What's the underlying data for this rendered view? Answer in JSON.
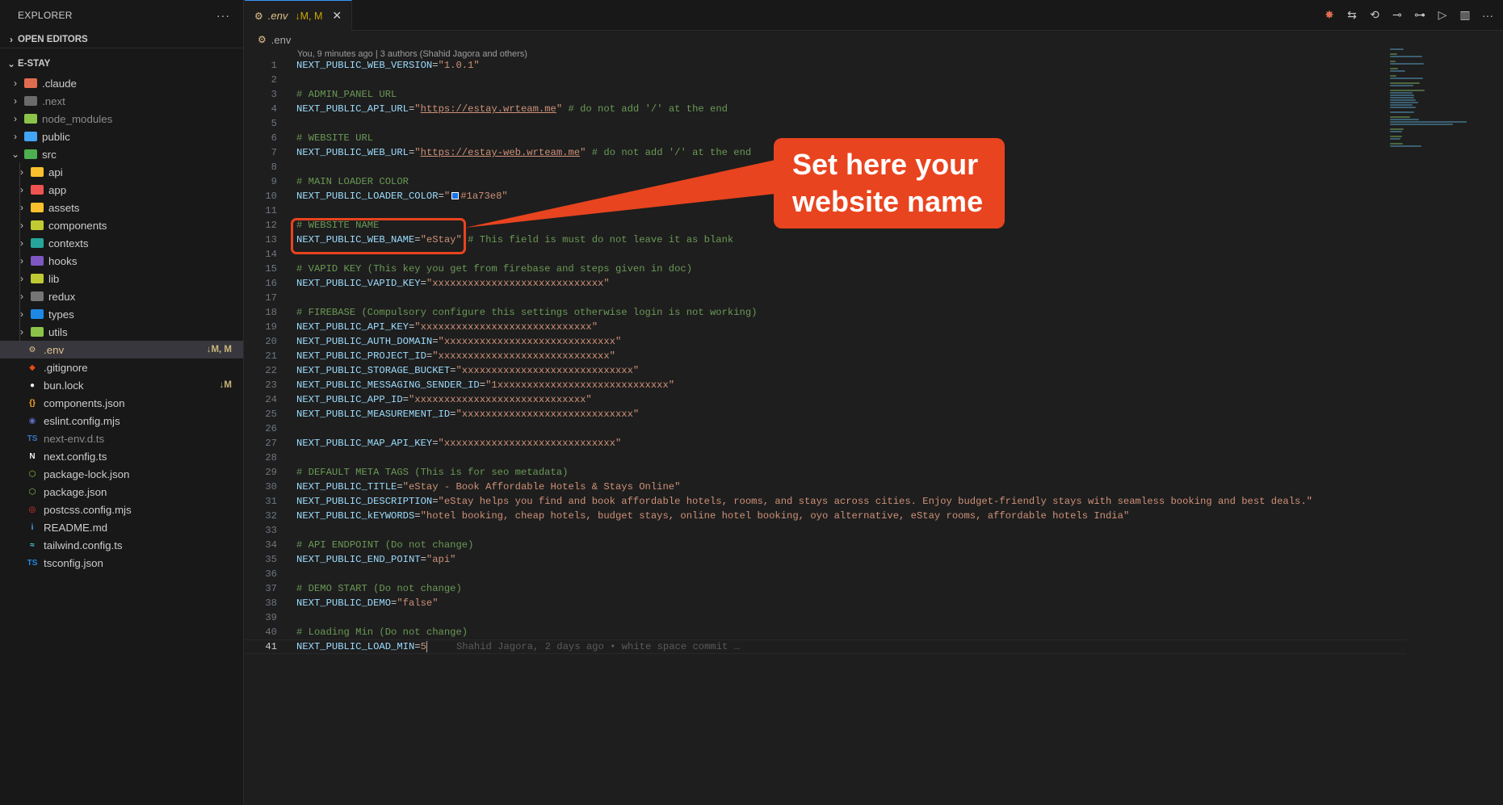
{
  "explorer": {
    "title": "EXPLORER",
    "more": "···",
    "open_editors": "OPEN EDITORS",
    "project": "E-STAY",
    "items": [
      {
        "label": ".claude",
        "type": "folder",
        "color": "#e06c4f",
        "dim": false,
        "badge": ""
      },
      {
        "label": ".next",
        "type": "folder",
        "color": "#6b6b6b",
        "dim": true,
        "badge": ""
      },
      {
        "label": "node_modules",
        "type": "folder",
        "color": "#8bc34a",
        "dim": true,
        "badge": ""
      },
      {
        "label": "public",
        "type": "folder",
        "color": "#42a5f5",
        "dim": false,
        "badge": ""
      },
      {
        "label": "src",
        "type": "folder-open",
        "color": "#4caf50",
        "dim": false,
        "badge": ""
      }
    ],
    "src_children": [
      {
        "label": "api",
        "color": "#fbc02d"
      },
      {
        "label": "app",
        "color": "#ef5350"
      },
      {
        "label": "assets",
        "color": "#fbc02d"
      },
      {
        "label": "components",
        "color": "#c0ca33"
      },
      {
        "label": "contexts",
        "color": "#26a69a"
      },
      {
        "label": "hooks",
        "color": "#7e57c2"
      },
      {
        "label": "lib",
        "color": "#c0ca33"
      },
      {
        "label": "redux",
        "color": "#757575"
      },
      {
        "label": "types",
        "color": "#1e88e5"
      },
      {
        "label": "utils",
        "color": "#8bc34a"
      }
    ],
    "files": [
      {
        "label": ".env",
        "icon": "⚙",
        "color": "#e2c08d",
        "badge": "↓M, M",
        "selected": true,
        "dim": false
      },
      {
        "label": ".gitignore",
        "icon": "◆",
        "color": "#e64a19",
        "badge": "",
        "selected": false,
        "dim": false
      },
      {
        "label": "bun.lock",
        "icon": "●",
        "color": "#f5f5f5",
        "badge": "↓M",
        "selected": false,
        "dim": false
      },
      {
        "label": "components.json",
        "icon": "{}",
        "color": "#f9a825",
        "badge": "",
        "selected": false,
        "dim": false
      },
      {
        "label": "eslint.config.mjs",
        "icon": "◉",
        "color": "#5c6bc0",
        "badge": "",
        "selected": false,
        "dim": false
      },
      {
        "label": "next-env.d.ts",
        "icon": "TS",
        "color": "#3178c6",
        "badge": "",
        "selected": false,
        "dim": true
      },
      {
        "label": "next.config.ts",
        "icon": "N",
        "color": "#eeeeee",
        "badge": "",
        "selected": false,
        "dim": false
      },
      {
        "label": "package-lock.json",
        "icon": "⬡",
        "color": "#8bc34a",
        "badge": "",
        "selected": false,
        "dim": false
      },
      {
        "label": "package.json",
        "icon": "⬡",
        "color": "#8bc34a",
        "badge": "",
        "selected": false,
        "dim": false
      },
      {
        "label": "postcss.config.mjs",
        "icon": "◎",
        "color": "#e53935",
        "badge": "",
        "selected": false,
        "dim": false
      },
      {
        "label": "README.md",
        "icon": "i",
        "color": "#42a5f5",
        "badge": "",
        "selected": false,
        "dim": false
      },
      {
        "label": "tailwind.config.ts",
        "icon": "≈",
        "color": "#4dd0e1",
        "badge": "",
        "selected": false,
        "dim": false
      },
      {
        "label": "tsconfig.json",
        "icon": "TS",
        "color": "#1e88e5",
        "badge": "",
        "selected": false,
        "dim": false
      }
    ]
  },
  "tab": {
    "icon": "⚙",
    "label": ".env",
    "badge": "↓M, M",
    "close": "✕"
  },
  "tab_actions": [
    "✸",
    "⇆",
    "⟲",
    "⊸",
    "⊶",
    "▷",
    "▥",
    "···"
  ],
  "breadcrumb": {
    "icon": "⚙",
    "label": ".env"
  },
  "blame_header": "You, 9 minutes ago | 3 authors (Shahid Jagora and others)",
  "code_lines": [
    {
      "n": "1",
      "segs": [
        {
          "t": "NEXT_PUBLIC_WEB_VERSION",
          "c": "k"
        },
        {
          "t": "=",
          "c": "p"
        },
        {
          "t": "\"1.0.1\"",
          "c": "v"
        }
      ]
    },
    {
      "n": "2",
      "segs": []
    },
    {
      "n": "3",
      "segs": [
        {
          "t": "# ADMIN_PANEL URL",
          "c": "c"
        }
      ]
    },
    {
      "n": "4",
      "segs": [
        {
          "t": "NEXT_PUBLIC_API_URL",
          "c": "k"
        },
        {
          "t": "=",
          "c": "p"
        },
        {
          "t": "\"",
          "c": "v"
        },
        {
          "t": "https://estay.wrteam.me",
          "c": "vu"
        },
        {
          "t": "\"",
          "c": "v"
        },
        {
          "t": " # do not add '/' at the end",
          "c": "c"
        }
      ]
    },
    {
      "n": "5",
      "segs": []
    },
    {
      "n": "6",
      "segs": [
        {
          "t": "# WEBSITE URL",
          "c": "c"
        }
      ]
    },
    {
      "n": "7",
      "segs": [
        {
          "t": "NEXT_PUBLIC_WEB_URL",
          "c": "k"
        },
        {
          "t": "=",
          "c": "p"
        },
        {
          "t": "\"",
          "c": "v"
        },
        {
          "t": "https://estay-web.wrteam.me",
          "c": "vu"
        },
        {
          "t": "\"",
          "c": "v"
        },
        {
          "t": " # do not add '/' at the end",
          "c": "c"
        }
      ]
    },
    {
      "n": "8",
      "segs": []
    },
    {
      "n": "9",
      "segs": [
        {
          "t": "# MAIN LOADER COLOR",
          "c": "c"
        }
      ]
    },
    {
      "n": "10",
      "segs": [
        {
          "t": "NEXT_PUBLIC_LOADER_COLOR",
          "c": "k"
        },
        {
          "t": "=",
          "c": "p"
        },
        {
          "t": "\"",
          "c": "v"
        },
        {
          "t": "",
          "c": "swatch"
        },
        {
          "t": "#1a73e8\"",
          "c": "v"
        }
      ]
    },
    {
      "n": "11",
      "segs": []
    },
    {
      "n": "12",
      "segs": [
        {
          "t": "# WEBSITE NAME",
          "c": "c"
        }
      ]
    },
    {
      "n": "13",
      "segs": [
        {
          "t": "NEXT_PUBLIC_WEB_NAME",
          "c": "k"
        },
        {
          "t": "=",
          "c": "p"
        },
        {
          "t": "\"eStay\"",
          "c": "v"
        },
        {
          "t": " # This field is must do not leave it as blank",
          "c": "c"
        }
      ]
    },
    {
      "n": "14",
      "segs": []
    },
    {
      "n": "15",
      "segs": [
        {
          "t": "# VAPID KEY (This key you get from firebase and steps given in doc)",
          "c": "c"
        }
      ]
    },
    {
      "n": "16",
      "segs": [
        {
          "t": "NEXT_PUBLIC_VAPID_KEY",
          "c": "k"
        },
        {
          "t": "=",
          "c": "p"
        },
        {
          "t": "\"xxxxxxxxxxxxxxxxxxxxxxxxxxxxx\"",
          "c": "v"
        }
      ]
    },
    {
      "n": "17",
      "segs": []
    },
    {
      "n": "18",
      "segs": [
        {
          "t": "# FIREBASE (Compulsory configure this settings otherwise login is not working)",
          "c": "c"
        }
      ]
    },
    {
      "n": "19",
      "segs": [
        {
          "t": "NEXT_PUBLIC_API_KEY",
          "c": "k"
        },
        {
          "t": "=",
          "c": "p"
        },
        {
          "t": "\"xxxxxxxxxxxxxxxxxxxxxxxxxxxxx\"",
          "c": "v"
        }
      ]
    },
    {
      "n": "20",
      "segs": [
        {
          "t": "NEXT_PUBLIC_AUTH_DOMAIN",
          "c": "k"
        },
        {
          "t": "=",
          "c": "p"
        },
        {
          "t": "\"xxxxxxxxxxxxxxxxxxxxxxxxxxxxx\"",
          "c": "v"
        }
      ]
    },
    {
      "n": "21",
      "segs": [
        {
          "t": "NEXT_PUBLIC_PROJECT_ID",
          "c": "k"
        },
        {
          "t": "=",
          "c": "p"
        },
        {
          "t": "\"xxxxxxxxxxxxxxxxxxxxxxxxxxxxx\"",
          "c": "v"
        }
      ]
    },
    {
      "n": "22",
      "segs": [
        {
          "t": "NEXT_PUBLIC_STORAGE_BUCKET",
          "c": "k"
        },
        {
          "t": "=",
          "c": "p"
        },
        {
          "t": "\"xxxxxxxxxxxxxxxxxxxxxxxxxxxxx\"",
          "c": "v"
        }
      ]
    },
    {
      "n": "23",
      "segs": [
        {
          "t": "NEXT_PUBLIC_MESSAGING_SENDER_ID",
          "c": "k"
        },
        {
          "t": "=",
          "c": "p"
        },
        {
          "t": "\"1xxxxxxxxxxxxxxxxxxxxxxxxxxxxx\"",
          "c": "v"
        }
      ]
    },
    {
      "n": "24",
      "segs": [
        {
          "t": "NEXT_PUBLIC_APP_ID",
          "c": "k"
        },
        {
          "t": "=",
          "c": "p"
        },
        {
          "t": "\"xxxxxxxxxxxxxxxxxxxxxxxxxxxxx\"",
          "c": "v"
        }
      ]
    },
    {
      "n": "25",
      "segs": [
        {
          "t": "NEXT_PUBLIC_MEASUREMENT_ID",
          "c": "k"
        },
        {
          "t": "=",
          "c": "p"
        },
        {
          "t": "\"xxxxxxxxxxxxxxxxxxxxxxxxxxxxx\"",
          "c": "v"
        }
      ]
    },
    {
      "n": "26",
      "segs": []
    },
    {
      "n": "27",
      "segs": [
        {
          "t": "NEXT_PUBLIC_MAP_API_KEY",
          "c": "k"
        },
        {
          "t": "=",
          "c": "p"
        },
        {
          "t": "\"xxxxxxxxxxxxxxxxxxxxxxxxxxxxx\"",
          "c": "v"
        }
      ]
    },
    {
      "n": "28",
      "segs": []
    },
    {
      "n": "29",
      "segs": [
        {
          "t": "# DEFAULT META TAGS (This is for seo metadata)",
          "c": "c"
        }
      ]
    },
    {
      "n": "30",
      "segs": [
        {
          "t": "NEXT_PUBLIC_TITLE",
          "c": "k"
        },
        {
          "t": "=",
          "c": "p"
        },
        {
          "t": "\"eStay - Book Affordable Hotels & Stays Online\"",
          "c": "v"
        }
      ]
    },
    {
      "n": "31",
      "segs": [
        {
          "t": "NEXT_PUBLIC_DESCRIPTION",
          "c": "k"
        },
        {
          "t": "=",
          "c": "p"
        },
        {
          "t": "\"eStay helps you find and book affordable hotels, rooms, and stays across cities. Enjoy budget-friendly stays with seamless booking and best deals.\"",
          "c": "v"
        }
      ]
    },
    {
      "n": "32",
      "segs": [
        {
          "t": "NEXT_PUBLIC_kEYWORDS",
          "c": "k"
        },
        {
          "t": "=",
          "c": "p"
        },
        {
          "t": "\"hotel booking, cheap hotels, budget stays, online hotel booking, oyo alternative, eStay rooms, affordable hotels India\"",
          "c": "v"
        }
      ]
    },
    {
      "n": "33",
      "segs": []
    },
    {
      "n": "34",
      "segs": [
        {
          "t": "# API ENDPOINT (Do not change)",
          "c": "c"
        }
      ]
    },
    {
      "n": "35",
      "segs": [
        {
          "t": "NEXT_PUBLIC_END_POINT",
          "c": "k"
        },
        {
          "t": "=",
          "c": "p"
        },
        {
          "t": "\"api\"",
          "c": "v"
        }
      ]
    },
    {
      "n": "36",
      "segs": []
    },
    {
      "n": "37",
      "segs": [
        {
          "t": "# DEMO START (Do not change)",
          "c": "c"
        }
      ]
    },
    {
      "n": "38",
      "segs": [
        {
          "t": "NEXT_PUBLIC_DEMO",
          "c": "k"
        },
        {
          "t": "=",
          "c": "p"
        },
        {
          "t": "\"false\"",
          "c": "v"
        }
      ]
    },
    {
      "n": "39",
      "segs": []
    },
    {
      "n": "40",
      "segs": [
        {
          "t": "# Loading Min (Do not change)",
          "c": "c"
        }
      ]
    },
    {
      "n": "41",
      "segs": [
        {
          "t": "NEXT_PUBLIC_LOAD_MIN",
          "c": "k"
        },
        {
          "t": "=",
          "c": "p"
        },
        {
          "t": "5",
          "c": "cur"
        },
        {
          "t": "Shahid Jagora, 2 days ago • white space commit …",
          "c": "blame"
        }
      ],
      "current": true
    }
  ],
  "annotation": {
    "text_line1": "Set here your",
    "text_line2": "website name",
    "color": "#e8441f"
  },
  "colors": {
    "key": "#9cdcfe",
    "value": "#ce9178",
    "comment": "#6a9955",
    "accent": "#3794ff",
    "modified": "#e2c08d"
  }
}
